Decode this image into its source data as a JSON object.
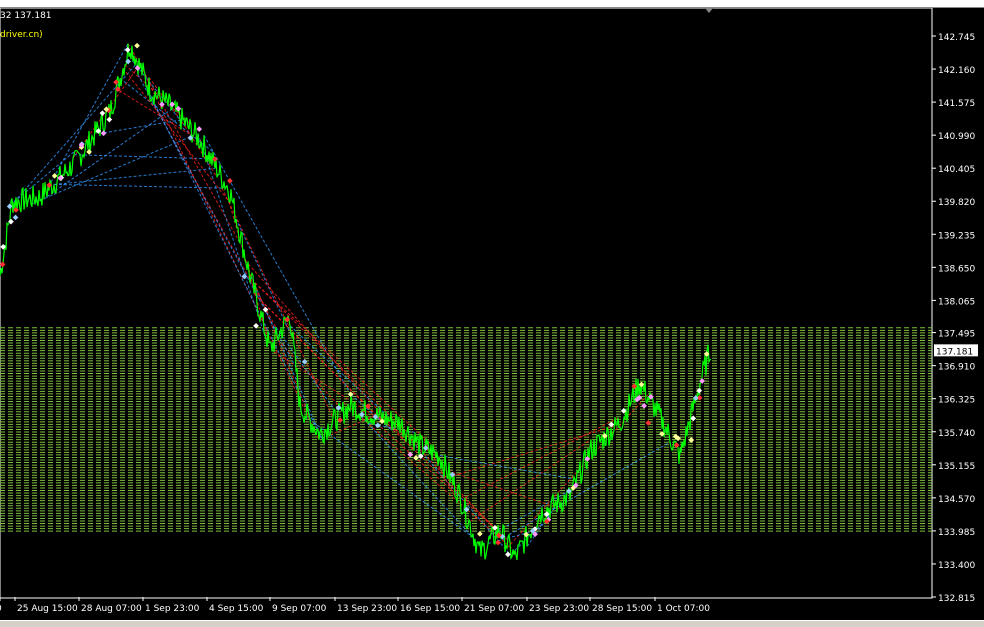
{
  "header": {
    "price_info": "32 137.181",
    "indicator_suffix": "driver.cn)"
  },
  "chart_data": {
    "type": "line",
    "title": "",
    "price_ticks": [
      "142.745",
      "142.160",
      "141.575",
      "140.990",
      "140.405",
      "139.820",
      "139.235",
      "138.650",
      "138.065",
      "137.495",
      "136.910",
      "136.325",
      "135.740",
      "135.155",
      "134.570",
      "133.985",
      "133.400",
      "132.815"
    ],
    "current_price": "137.181",
    "time_labels": [
      "0",
      "25 Aug 15:00",
      "28 Aug 07:00",
      "1 Sep 23:00",
      "4 Sep 15:00",
      "9 Sep 07:00",
      "13 Sep 23:00",
      "16 Sep 15:00",
      "21 Sep 07:00",
      "23 Sep 23:00",
      "28 Sep 15:00",
      "1 Oct 07:00"
    ],
    "ylim": [
      132.815,
      142.745
    ],
    "series": [
      {
        "name": "price",
        "color": "#00ff00",
        "bar_index": [
          0,
          12,
          40,
          75,
          110,
          130,
          150,
          170,
          200,
          230,
          250,
          270,
          290,
          300,
          320,
          350,
          380,
          400,
          420,
          440,
          460,
          480,
          500,
          515,
          540,
          570,
          590,
          620,
          640,
          660,
          680,
          700,
          712
        ],
        "values": [
          138.5,
          139.8,
          139.9,
          140.5,
          141.4,
          142.6,
          141.8,
          141.5,
          140.9,
          140.0,
          138.5,
          137.2,
          137.8,
          136.2,
          135.7,
          136.2,
          136.0,
          135.9,
          135.5,
          135.3,
          134.6,
          133.6,
          134.0,
          133.5,
          134.3,
          134.6,
          135.4,
          135.9,
          136.6,
          136.0,
          135.3,
          136.6,
          137.3
        ]
      }
    ],
    "level_range": [
      133.98,
      137.6
    ],
    "colors": {
      "price": "#00ff00",
      "levels": "#7fbf3f",
      "up": "#3399ff",
      "down": "#ff2020"
    }
  }
}
